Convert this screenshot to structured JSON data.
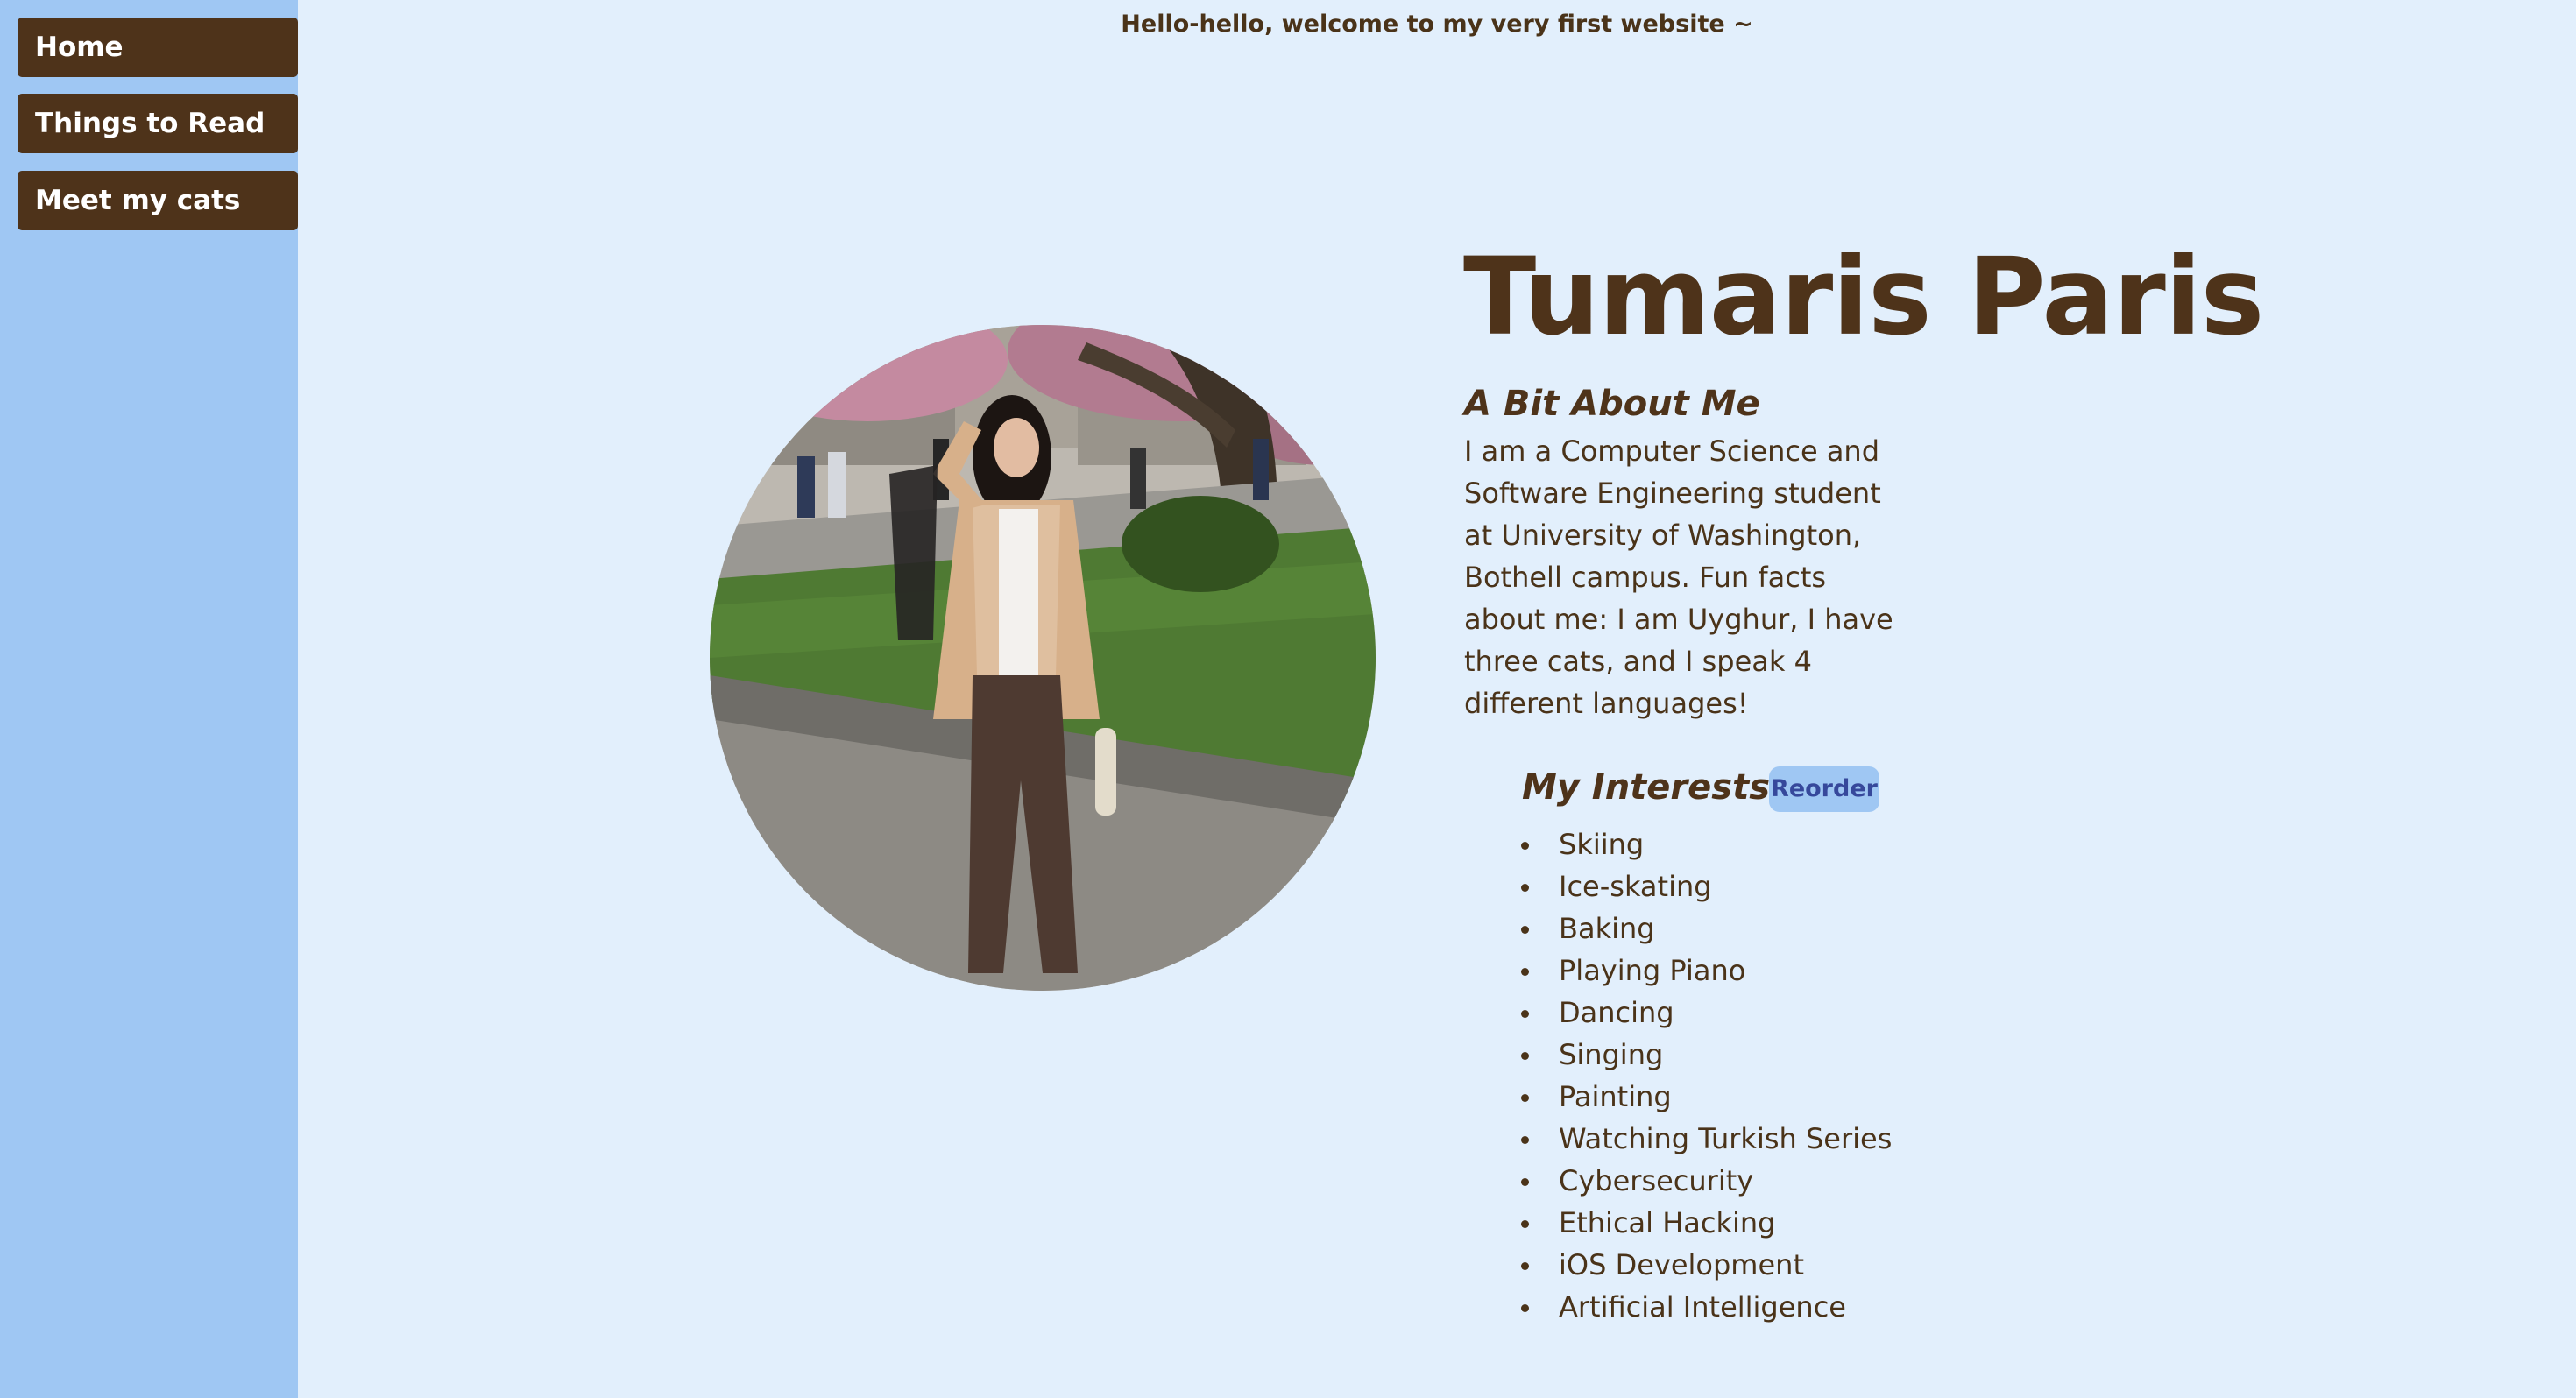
{
  "nav": {
    "items": [
      {
        "label": "Home"
      },
      {
        "label": "Things to Read"
      },
      {
        "label": "Meet my cats"
      }
    ]
  },
  "header": {
    "welcome": "Hello-hello, welcome to my very first website ~"
  },
  "profile": {
    "name": "Tumaris Paris",
    "photo_icon": "profile-photo",
    "about_title": "A Bit About Me",
    "about_text": "I am a Computer Science and Software Engineering student at University of Washington, Bothell campus. Fun facts about me: I am Uyghur, I have three cats, and I speak 4 different languages!"
  },
  "interests": {
    "title": "My Interests",
    "reorder_label": "Reorder",
    "items": [
      "Skiing",
      "Ice-skating",
      "Baking",
      "Playing Piano",
      "Dancing",
      "Singing",
      "Painting",
      "Watching Turkish Series",
      "Cybersecurity",
      "Ethical Hacking",
      "iOS Development",
      "Artificial Intelligence"
    ]
  },
  "colors": {
    "page_background": "#e2effc",
    "sidebar_background": "#9fc7f3",
    "nav_button": "#4e331a",
    "text_brown": "#4a3319",
    "reorder_text": "#36489b"
  }
}
